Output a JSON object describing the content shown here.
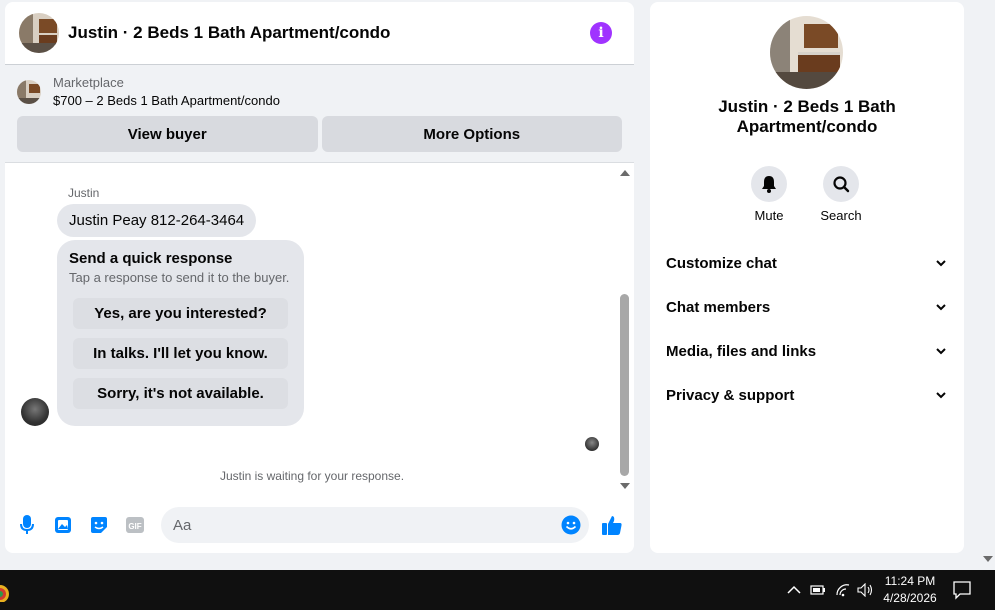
{
  "chat": {
    "title": "Justin · 2 Beds 1 Bath Apartment/condo",
    "marketplace_label": "Marketplace",
    "listing_title": "$700 – 2 Beds 1 Bath Apartment/condo",
    "view_buyer": "View buyer",
    "more_options": "More Options",
    "sender_name": "Justin",
    "message": "Justin Peay 812-264-3464",
    "quick_response_title": "Send a quick response",
    "quick_response_sub": "Tap a response to send it to the buyer.",
    "quick_responses": [
      "Yes, are you interested?",
      "In talks. I'll let you know.",
      "Sorry, it's not available."
    ],
    "waiting": "Justin is waiting for your response.",
    "input_placeholder": "Aa",
    "gif_label": "GIF"
  },
  "side": {
    "title_line1": "Justin · 2 Beds 1 Bath",
    "title_line2": "Apartment/condo",
    "mute": "Mute",
    "search": "Search",
    "sections": [
      "Customize chat",
      "Chat members",
      "Media, files and links",
      "Privacy & support"
    ]
  },
  "taskbar": {
    "time": "11:24 PM",
    "date": "4/28/2026"
  },
  "colors": {
    "accent": "#0084ff",
    "info": "#a033ff"
  }
}
